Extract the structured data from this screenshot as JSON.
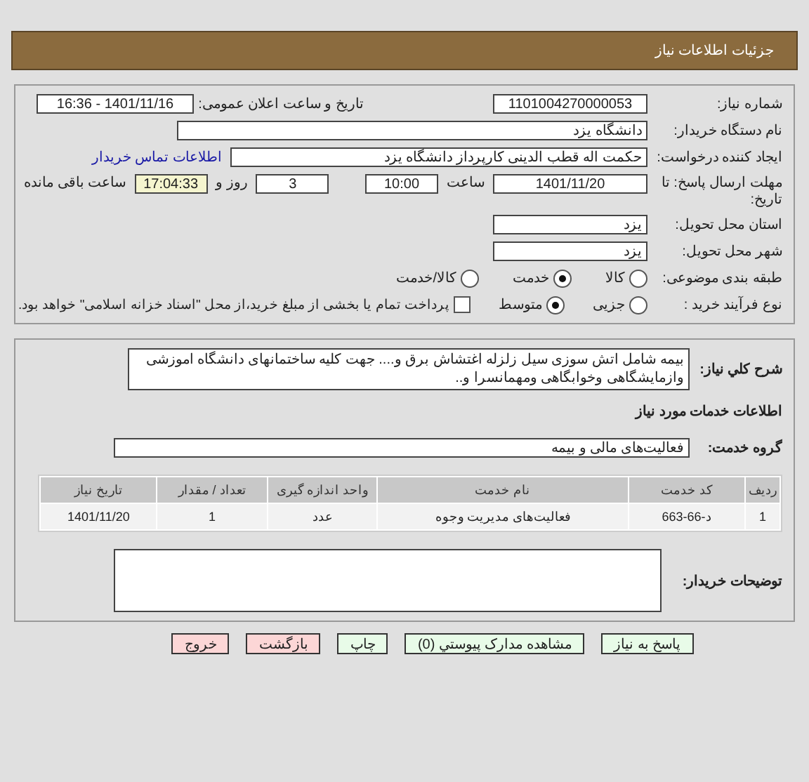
{
  "header": {
    "title": "جزئیات اطلاعات نیاز"
  },
  "need_number": {
    "label": "شماره نیاز:",
    "value": "1101004270000053"
  },
  "announce": {
    "label": "تاریخ و ساعت اعلان عمومی:",
    "value": "1401/11/16 - 16:36"
  },
  "buyer_org": {
    "label": "نام دستگاه خریدار:",
    "value": "دانشگاه یزد"
  },
  "requester": {
    "label": "ایجاد کننده درخواست:",
    "value": "حکمت اله قطب الدینی کارپرداز دانشگاه یزد",
    "link": "اطلاعات تماس خریدار"
  },
  "deadline": {
    "label": "مهلت ارسال پاسخ: تا تاریخ:",
    "date": "1401/11/20",
    "time_label": "ساعت",
    "time": "10:00",
    "days": "3",
    "days_label": "روز و",
    "remaining": "17:04:33",
    "remaining_label": "ساعت باقی مانده"
  },
  "province": {
    "label": "استان محل تحویل:",
    "value": "یزد"
  },
  "city": {
    "label": "شهر محل تحویل:",
    "value": "یزد"
  },
  "category": {
    "label": "طبقه بندی موضوعی:",
    "options": [
      {
        "label": "کالا",
        "selected": false
      },
      {
        "label": "خدمت",
        "selected": true
      },
      {
        "label": "کالا/خدمت",
        "selected": false
      }
    ]
  },
  "process": {
    "label": "نوع فرآیند خرید :",
    "options": [
      {
        "label": "جزیی",
        "selected": false
      },
      {
        "label": "متوسط",
        "selected": true
      }
    ],
    "treasury": {
      "label": "پرداخت تمام یا بخشی از مبلغ خرید،از محل \"اسناد خزانه اسلامی\" خواهد بود.",
      "checked": false
    }
  },
  "description": {
    "label": "شرح کلي نیاز:",
    "value": "بیمه شامل اتش سوزی سیل زلزله اغتشاش برق و.... جهت کلیه ساختمانهای دانشگاه اموزشی وازمایشگاهی وخوابگاهی ومهمانسرا و.."
  },
  "services_title": "اطلاعات خدمات مورد نیاز",
  "service_group": {
    "label": "گروه خدمت:",
    "value": "فعالیت‌های مالی و بیمه"
  },
  "table": {
    "columns": [
      "ردیف",
      "کد خدمت",
      "نام خدمت",
      "واحد اندازه گیری",
      "تعداد / مقدار",
      "تاریخ نیاز"
    ],
    "rows": [
      [
        "1",
        "د-66-663",
        "فعالیت‌های مدیریت وجوه",
        "عدد",
        "1",
        "1401/11/20"
      ]
    ]
  },
  "buyer_notes": {
    "label": "توضیحات خریدار:"
  },
  "buttons": [
    {
      "label": "پاسخ به نیاز",
      "kind": "primary"
    },
    {
      "label": "مشاهده مدارک پیوستي (0)",
      "kind": "primary"
    },
    {
      "label": "چاپ",
      "kind": "primary"
    },
    {
      "label": "بازگشت",
      "kind": "danger"
    },
    {
      "label": "خروج",
      "kind": "danger"
    }
  ]
}
